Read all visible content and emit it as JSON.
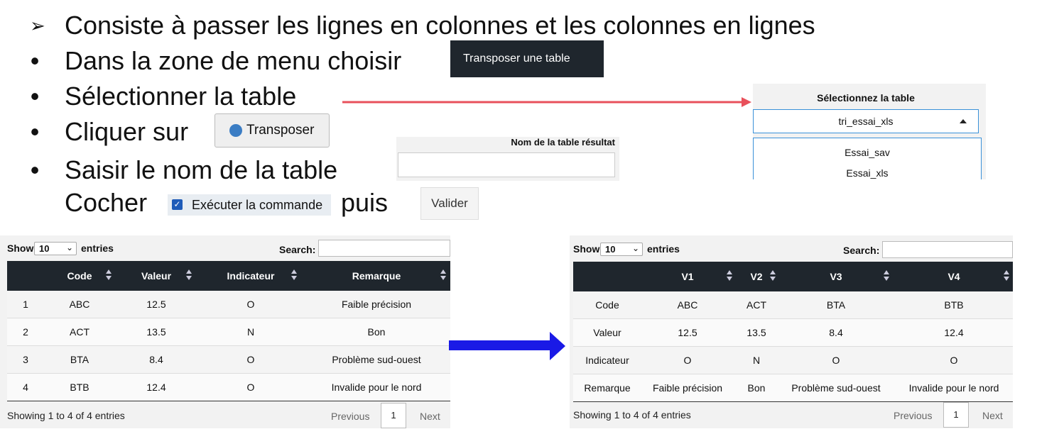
{
  "bullets": [
    {
      "marker": "➢",
      "text": "Consiste à passer les lignes en colonnes et les colonnes en lignes"
    },
    {
      "marker": "•",
      "text": "Dans la zone de menu choisir"
    },
    {
      "marker": "•",
      "text": "Sélectionner la table"
    },
    {
      "marker": "•",
      "text": "Cliquer sur"
    },
    {
      "marker": "•",
      "text": "Saisir le nom de la table"
    }
  ],
  "cocher_text": "Cocher",
  "puis_text": "puis",
  "menu_button_label": "Transposer une table",
  "transposer_button_label": "Transposer",
  "nom_table": {
    "label": "Nom de la table résultat",
    "value": ""
  },
  "execute_checkbox": {
    "label": "Exécuter la commande",
    "checked": true
  },
  "valider_label": "Valider",
  "select_table": {
    "label": "Sélectionnez la table",
    "selected": "tri_essai_xls",
    "options": [
      "Essai_sav",
      "Essai_xls"
    ]
  },
  "colors": {
    "arrow_red": "#e8505b",
    "arrow_blue": "#1a1ae6",
    "header_bg": "#1f262d",
    "select_border": "#3a91d8"
  },
  "table_before": {
    "show_label": "Show",
    "entries_count": "10",
    "entries_label": "entries",
    "search_label": "Search:",
    "headers": [
      "",
      "Code",
      "Valeur",
      "Indicateur",
      "Remarque"
    ],
    "rows": [
      [
        "1",
        "ABC",
        "12.5",
        "O",
        "Faible précision"
      ],
      [
        "2",
        "ACT",
        "13.5",
        "N",
        "Bon"
      ],
      [
        "3",
        "BTA",
        "8.4",
        "O",
        "Problème sud-ouest"
      ],
      [
        "4",
        "BTB",
        "12.4",
        "O",
        "Invalide pour le nord"
      ]
    ],
    "footer": "Showing 1 to 4 of 4 entries",
    "previous": "Previous",
    "page": "1",
    "next": "Next"
  },
  "table_after": {
    "show_label": "Show",
    "entries_count": "10",
    "entries_label": "entries",
    "search_label": "Search:",
    "headers": [
      "",
      "V1",
      "V2",
      "V3",
      "V4"
    ],
    "rows": [
      [
        "Code",
        "ABC",
        "ACT",
        "BTA",
        "BTB"
      ],
      [
        "Valeur",
        "12.5",
        "13.5",
        "8.4",
        "12.4"
      ],
      [
        "Indicateur",
        "O",
        "N",
        "O",
        "O"
      ],
      [
        "Remarque",
        "Faible précision",
        "Bon",
        "Problème sud-ouest",
        "Invalide pour le nord"
      ]
    ],
    "footer": "Showing 1 to 4 of 4 entries",
    "previous": "Previous",
    "page": "1",
    "next": "Next"
  }
}
